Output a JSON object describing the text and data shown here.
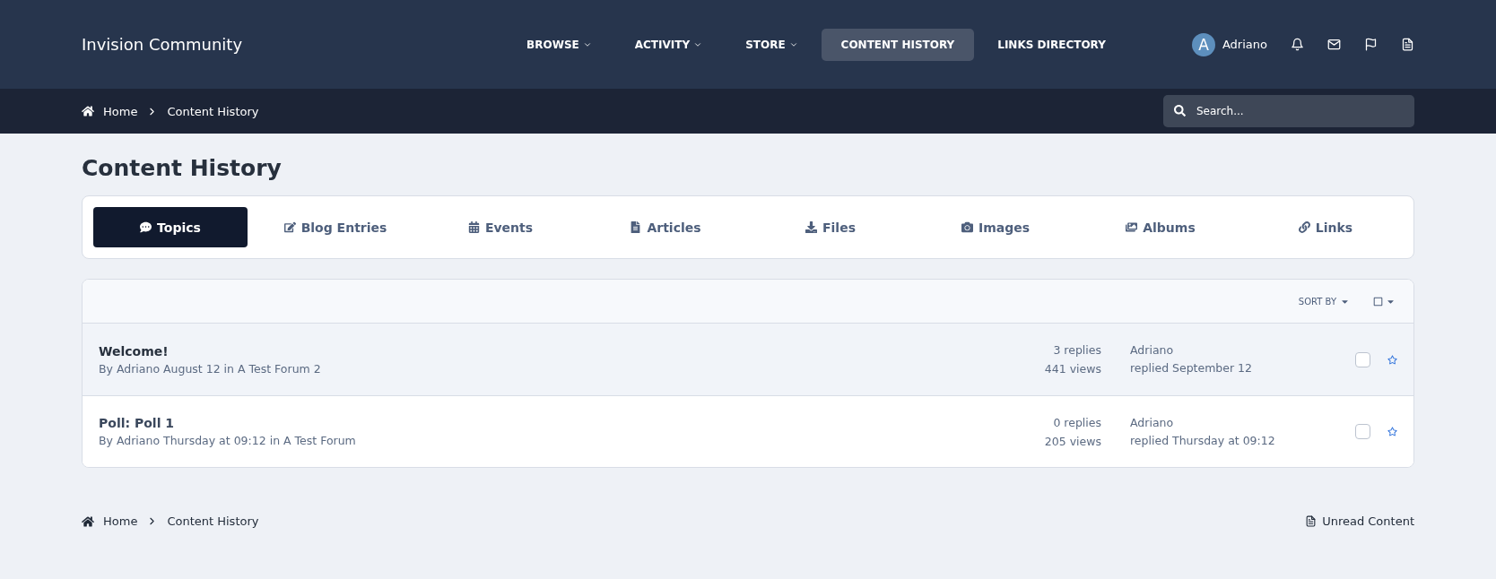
{
  "site_title": "Invision Community",
  "nav": [
    {
      "label": "BROWSE",
      "has_menu": true,
      "selected": false
    },
    {
      "label": "ACTIVITY",
      "has_menu": true,
      "selected": false
    },
    {
      "label": "STORE",
      "has_menu": true,
      "selected": false
    },
    {
      "label": "CONTENT HISTORY",
      "has_menu": false,
      "selected": true
    },
    {
      "label": "LINKS DIRECTORY",
      "has_menu": false,
      "selected": false
    }
  ],
  "user": {
    "avatar_letter": "A",
    "name": "Adriano"
  },
  "user_icons": [
    {
      "kind": "bell"
    },
    {
      "kind": "mail"
    },
    {
      "kind": "flag"
    },
    {
      "kind": "document"
    }
  ],
  "breadcrumb": [
    "Home",
    "Content History"
  ],
  "search": {
    "placeholder": "Search..."
  },
  "page_title": "Content History",
  "tabs": [
    {
      "label": "Topics",
      "kind": "comment",
      "selected": true
    },
    {
      "label": "Blog Entries",
      "kind": "edit",
      "selected": false
    },
    {
      "label": "Events",
      "kind": "calendar",
      "selected": false
    },
    {
      "label": "Articles",
      "kind": "file",
      "selected": false
    },
    {
      "label": "Files",
      "kind": "download",
      "selected": false
    },
    {
      "label": "Images",
      "kind": "camera",
      "selected": false
    },
    {
      "label": "Albums",
      "kind": "images",
      "selected": false
    },
    {
      "label": "Links",
      "kind": "link",
      "selected": false
    }
  ],
  "list": {
    "sort_label": "SORT BY",
    "rows": [
      {
        "title": "Welcome!",
        "meta": "By Adriano August 12 in A Test Forum 2",
        "replies": "3 replies",
        "views": "441 views",
        "last_user": "Adriano",
        "last_time": "replied September 12",
        "unread": true,
        "checked": false
      },
      {
        "title": "Poll: Poll 1",
        "meta": "By Adriano Thursday at 09:12 in A Test Forum",
        "replies": "0 replies",
        "views": "205 views",
        "last_user": "Adriano",
        "last_time": "replied Thursday at 09:12",
        "unread": false,
        "checked": false
      }
    ]
  },
  "footer_breadcrumb": [
    "Home",
    "Content History"
  ],
  "footer_link": "Unread Content"
}
